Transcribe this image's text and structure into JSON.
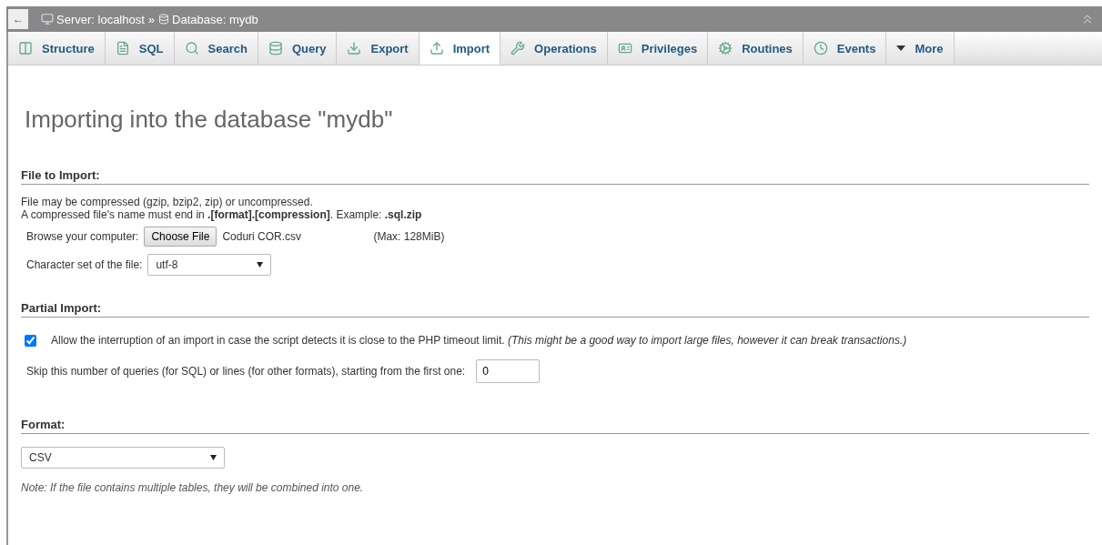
{
  "breadcrumb": {
    "back": "←",
    "server": "Server: localhost",
    "separator": "»",
    "database": "Database: mydb"
  },
  "tabs": [
    {
      "label": "Structure",
      "selected": false
    },
    {
      "label": "SQL",
      "selected": false
    },
    {
      "label": "Search",
      "selected": false
    },
    {
      "label": "Query",
      "selected": false
    },
    {
      "label": "Export",
      "selected": false
    },
    {
      "label": "Import",
      "selected": true
    },
    {
      "label": "Operations",
      "selected": false
    },
    {
      "label": "Privileges",
      "selected": false
    },
    {
      "label": "Routines",
      "selected": false
    },
    {
      "label": "Events",
      "selected": false
    },
    {
      "label": "More",
      "selected": false
    }
  ],
  "title": "Importing into the database \"mydb\"",
  "file_section": {
    "heading": "File to Import:",
    "notes": [
      "File may be compressed (gzip, bzip2, zip) or uncompressed.",
      "A compressed file's name must end in **.[format].[compression]**. Example: **.sql.zip**"
    ],
    "browse_label": "Browse your computer:",
    "choose_button": "Choose File",
    "file_name": "Coduri COR.csv",
    "max": "(Max: 128MiB)",
    "charset_label": "Character set of the file:",
    "charset": "utf-8"
  },
  "partial_section": {
    "heading": "Partial Import:",
    "allow_interrupt": {
      "checked": true,
      "label": "Allow the interruption of an import in case the script detects it is close to the PHP timeout limit. *(This might be a good way to import large files, however it can break transactions.)*"
    },
    "skip_label": "Skip this number of queries (for SQL) or lines (for other formats), starting from the first one:",
    "skip_value": "0"
  },
  "format_section": {
    "heading": "Format:",
    "format": "CSV",
    "note": "Note: If the file contains multiple tables, they will be combined into one."
  }
}
